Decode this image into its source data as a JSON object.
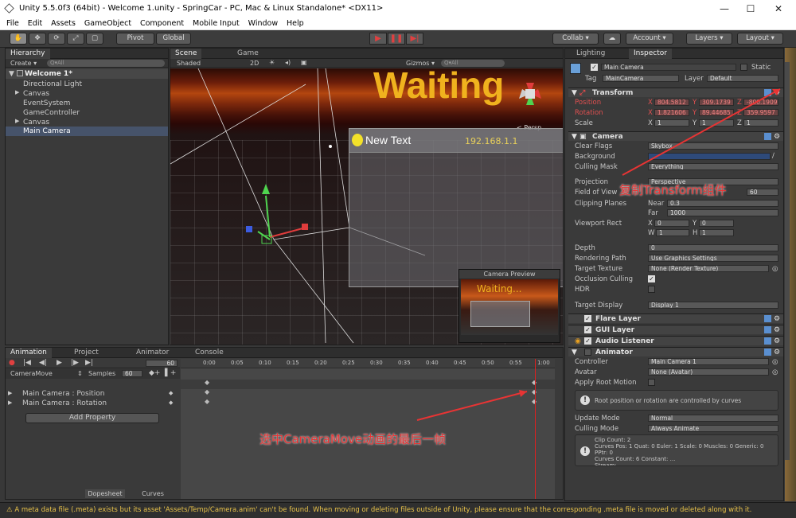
{
  "window": {
    "title": "Unity 5.5.0f3 (64bit) - Welcome 1.unity - SpringCar - PC, Mac & Linux Standalone* <DX11>",
    "minimize": "—",
    "maximize": "☐",
    "close": "✕"
  },
  "menu": [
    "File",
    "Edit",
    "Assets",
    "GameObject",
    "Component",
    "Mobile Input",
    "Window",
    "Help"
  ],
  "toolbar": {
    "pivot": "Pivot",
    "global": "Global",
    "collab": "Collab ▾",
    "account": "Account ▾",
    "layers": "Layers ▾",
    "layout": "Layout ▾"
  },
  "hierarchy": {
    "tab": "Hierarchy",
    "create": "Create ▾",
    "search": "Q▾All",
    "scene": "Welcome 1*",
    "items": [
      "Directional Light",
      "Canvas",
      "EventSystem",
      "GameController",
      "Canvas",
      "Main Camera"
    ]
  },
  "scene": {
    "tab_scene": "Scene",
    "tab_game": "Game",
    "shading": "Shaded",
    "mode2d": "2D",
    "gizmos": "Gizmos ▾",
    "search": "Q▾All",
    "persp": "< Persp",
    "waiting": "Waiting",
    "newtext": "New Text",
    "ip": "192.168.1.1",
    "preview_title": "Camera Preview",
    "preview_text": "Waiting..."
  },
  "inspector": {
    "tab_lighting": "Lighting",
    "tab_inspector": "Inspector",
    "name": "Main Camera",
    "static": "Static",
    "tag_label": "Tag",
    "tag": "MainCamera",
    "layer_label": "Layer",
    "layer": "Default",
    "transform": {
      "title": "Transform",
      "position_label": "Position",
      "rotation_label": "Rotation",
      "scale_label": "Scale",
      "pos": [
        "804.5812",
        "309.1739",
        "-800.1909"
      ],
      "rot": [
        "1.821606",
        "89.44685",
        "359.9597"
      ],
      "scale": [
        "1",
        "1",
        "1"
      ]
    },
    "camera": {
      "title": "Camera",
      "clear_flags_label": "Clear Flags",
      "clear_flags": "Skybox",
      "background_label": "Background",
      "culling_label": "Culling Mask",
      "culling": "Everything",
      "projection_label": "Projection",
      "projection": "Perspective",
      "fov_label": "Field of View",
      "fov": "60",
      "clip_label": "Clipping Planes",
      "near_label": "Near",
      "near": "0.3",
      "far_label": "Far",
      "far": "1000",
      "viewport_label": "Viewport Rect",
      "vx": "0",
      "vy": "0",
      "vw": "1",
      "vh": "1",
      "depth_label": "Depth",
      "depth": "0",
      "render_path_label": "Rendering Path",
      "render_path": "Use Graphics Settings",
      "target_tex_label": "Target Texture",
      "target_tex": "None (Render Texture)",
      "occlusion_label": "Occlusion Culling",
      "hdr_label": "HDR",
      "target_display_label": "Target Display",
      "target_display": "Display 1"
    },
    "flare": "Flare Layer",
    "gui": "GUI Layer",
    "audio": "Audio Listener",
    "animator": {
      "title": "Animator",
      "controller_label": "Controller",
      "controller": "Main Camera 1",
      "avatar_label": "Avatar",
      "avatar": "None (Avatar)",
      "root_motion_label": "Apply Root Motion",
      "info": "Root position or rotation are controlled by curves",
      "update_label": "Update Mode",
      "update": "Normal",
      "culling_label": "Culling Mode",
      "culling": "Always Animate",
      "clip_info": "Clip Count: 2\nCurves Pos: 1 Quat: 0 Euler: 1 Scale: 0 Muscles: 0 Generic: 0 PPtr: 0\nCurves Count: 6 Constant: ...\nStream: ..."
    }
  },
  "animation": {
    "tab_animation": "Animation",
    "tab_project": "Project",
    "tab_animator": "Animator",
    "tab_console": "Console",
    "frame": "60",
    "clip": "CameraMove",
    "samples_label": "Samples",
    "samples": "60",
    "tracks": [
      "Main Camera : Position",
      "Main Camera : Rotation"
    ],
    "add_property": "Add Property",
    "dopesheet": "Dopesheet",
    "curves": "Curves",
    "ticks": [
      "0:00",
      "0:05",
      "0:10",
      "0:15",
      "0:20",
      "0:25",
      "0:30",
      "0:35",
      "0:40",
      "0:45",
      "0:50",
      "0:55",
      "1:00"
    ]
  },
  "status": "⚠ A meta data file (.meta) exists but its asset 'Assets/Temp/Camera.anim' can't be found. When moving or deleting files outside of Unity, please ensure that the corresponding .meta file is moved or deleted along with it.",
  "annotations": {
    "a1": "复制Transform组件",
    "a2": "选中CameraMove动画的最后一帧"
  }
}
